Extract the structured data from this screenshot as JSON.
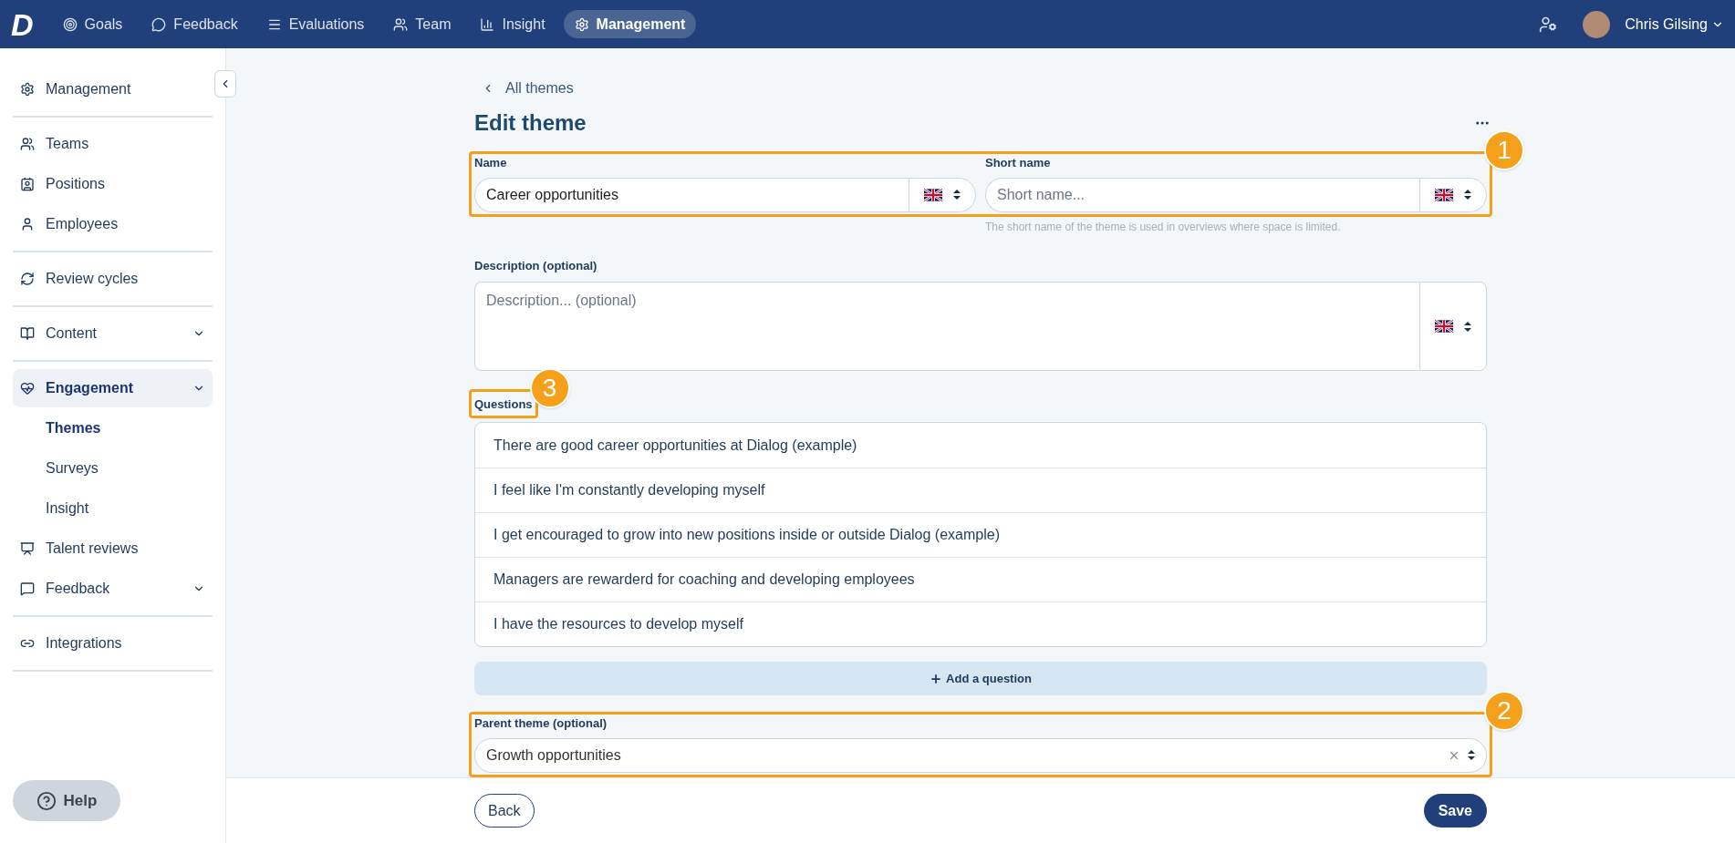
{
  "topnav": {
    "logo": "D",
    "items": [
      {
        "label": "Goals",
        "selected": false
      },
      {
        "label": "Feedback",
        "selected": false
      },
      {
        "label": "Evaluations",
        "selected": false
      },
      {
        "label": "Team",
        "selected": false
      },
      {
        "label": "Insight",
        "selected": false
      },
      {
        "label": "Management",
        "selected": true
      }
    ],
    "user": "Chris Gilsing"
  },
  "sidebar": {
    "groups": [
      [
        {
          "label": "Management",
          "expandable": false,
          "selected": false
        }
      ],
      [
        {
          "label": "Teams",
          "expandable": false,
          "selected": false
        },
        {
          "label": "Positions",
          "expandable": false,
          "selected": false
        },
        {
          "label": "Employees",
          "expandable": false,
          "selected": false
        }
      ],
      [
        {
          "label": "Review cycles",
          "expandable": false,
          "selected": false
        }
      ],
      [
        {
          "label": "Content",
          "expandable": true,
          "selected": false
        }
      ],
      [
        {
          "label": "Engagement",
          "expandable": true,
          "selected": true,
          "children": [
            {
              "label": "Themes",
              "selected": true
            },
            {
              "label": "Surveys",
              "selected": false
            },
            {
              "label": "Insight",
              "selected": false
            }
          ]
        },
        {
          "label": "Talent reviews",
          "expandable": false,
          "selected": false
        },
        {
          "label": "Feedback",
          "expandable": true,
          "selected": false
        }
      ],
      [
        {
          "label": "Integrations",
          "expandable": false,
          "selected": false
        }
      ]
    ],
    "help": "Help"
  },
  "breadcrumb": "All themes",
  "title": "Edit theme",
  "form": {
    "name": {
      "label": "Name",
      "value": "Career opportunities"
    },
    "short_name": {
      "label": "Short name",
      "placeholder": "Short name...",
      "hint": "The short name of the theme is used in overviews where space is limited."
    },
    "description": {
      "label": "Description (optional)",
      "placeholder": "Description... (optional)"
    },
    "questions": {
      "label": "Questions",
      "items": [
        "There are good career opportunities at Dialog (example)",
        "I feel like I'm constantly developing myself",
        "I get encouraged to grow into new positions inside or outside Dialog (example)",
        "Managers are rewarderd for coaching and developing employees",
        "I have the resources to develop myself"
      ],
      "add": "Add a question"
    },
    "parent_theme": {
      "label": "Parent theme (optional)",
      "value": "Growth opportunities"
    }
  },
  "annotations": {
    "name_row": "1",
    "parent_theme": "2",
    "questions": "3"
  },
  "footer": {
    "back": "Back",
    "save": "Save"
  }
}
